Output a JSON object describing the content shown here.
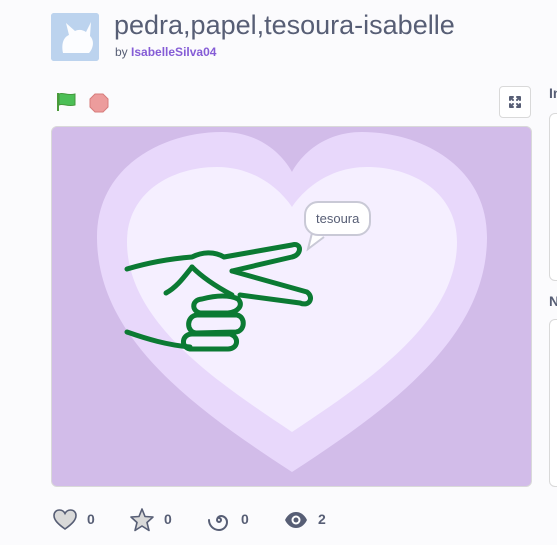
{
  "project": {
    "title": "pedra,papel,tesoura-isabelle",
    "by_label": "by",
    "author": "IsabelleSilva04"
  },
  "stage": {
    "speech_text": "tesoura"
  },
  "stats": {
    "loves": "0",
    "favorites": "0",
    "remixes": "0",
    "views": "2"
  },
  "right_panel": {
    "instructions_heading": "In",
    "notes_heading": "N"
  },
  "colors": {
    "stage_bg": "#d2bce9",
    "heart_outer": "#e8d8fb",
    "heart_inner": "#f5efff",
    "drawing_stroke": "#0b7a33",
    "author_link": "#855cd6",
    "text": "#575e75"
  }
}
